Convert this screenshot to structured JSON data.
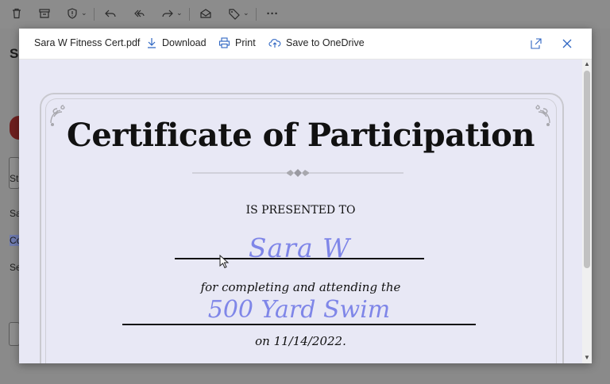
{
  "background": {
    "left_fragments": [
      "S",
      "St",
      "Sa",
      "Co",
      "Se"
    ]
  },
  "dialog": {
    "file_name": "Sara W Fitness Cert.pdf",
    "download_label": "Download",
    "print_label": "Print",
    "onedrive_label": "Save to OneDrive"
  },
  "certificate": {
    "title": "Certificate of Participation",
    "presented_to": "IS PRESENTED TO",
    "recipient": "Sara W",
    "completing_text": "for completing and attending the",
    "event": "500 Yard Swim",
    "date_text": "on 11/14/2022."
  },
  "colors": {
    "accent_script": "#7f86e8",
    "viewer_bg": "#e8e8f5"
  }
}
